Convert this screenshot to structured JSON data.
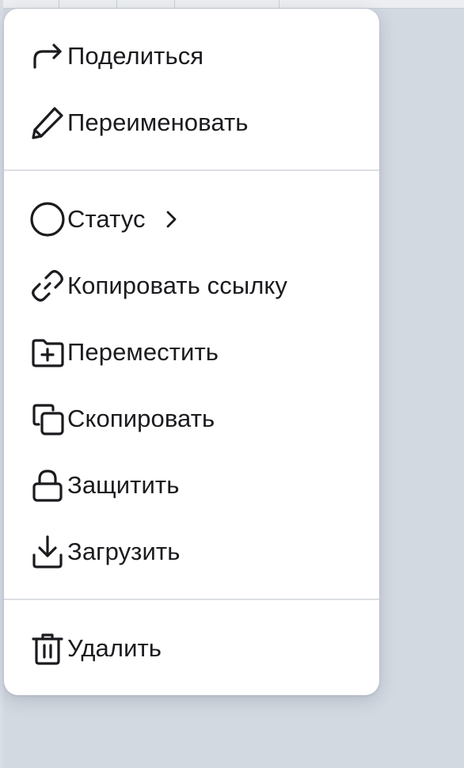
{
  "menu": {
    "groups": [
      {
        "items": [
          {
            "label": "Поделиться",
            "icon": "share-icon"
          },
          {
            "label": "Переименовать",
            "icon": "pencil-icon"
          }
        ]
      },
      {
        "items": [
          {
            "label": "Статус",
            "icon": "circle-icon",
            "submenu": true
          },
          {
            "label": "Копировать ссылку",
            "icon": "link-icon"
          },
          {
            "label": "Переместить",
            "icon": "folder-plus-icon"
          },
          {
            "label": "Скопировать",
            "icon": "copy-icon"
          },
          {
            "label": "Защитить",
            "icon": "lock-icon"
          },
          {
            "label": "Загрузить",
            "icon": "download-icon"
          }
        ]
      },
      {
        "items": [
          {
            "label": "Удалить",
            "icon": "trash-icon"
          }
        ]
      }
    ]
  },
  "colors": {
    "menu_background": "#ffffff",
    "text": "#1b1b1f",
    "separator": "#dcdfe3",
    "page_background": "#d3d9e1"
  }
}
